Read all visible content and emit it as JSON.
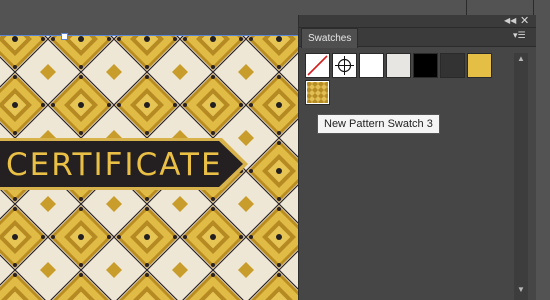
{
  "canvas": {
    "banner_text": "CERTIFICATE",
    "colors": {
      "gold": "#d8b24a",
      "dark": "#242021",
      "cream": "#efe7d6"
    }
  },
  "panel": {
    "tab_label": "Swatches",
    "collapse_icon": "double-chevron-left-icon",
    "close_icon": "close-icon",
    "menu_icon": "panel-menu-icon",
    "swatches": [
      {
        "name": "None",
        "color": "none"
      },
      {
        "name": "Registration",
        "color": "registration"
      },
      {
        "name": "White",
        "color": "#ffffff"
      },
      {
        "name": "Light Gray",
        "color": "#e8e6e3"
      },
      {
        "name": "Black",
        "color": "#000000"
      },
      {
        "name": "Dark Gray",
        "color": "#333333"
      },
      {
        "name": "Gold",
        "color": "#e5bf45"
      },
      {
        "name": "New Pattern Swatch 3",
        "color": "pattern"
      }
    ],
    "tooltip": "New Pattern Swatch 3"
  }
}
